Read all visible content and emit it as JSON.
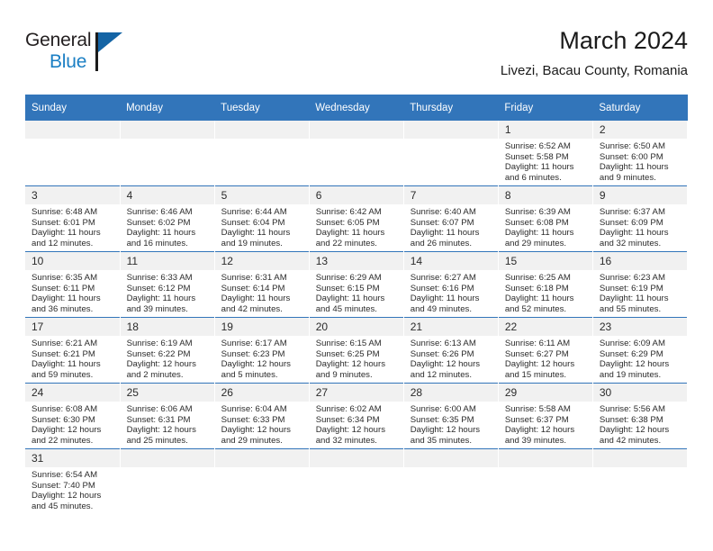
{
  "brand": {
    "name_part1": "General",
    "name_part2": "Blue",
    "logo_icon": "triangle-flag-icon"
  },
  "header": {
    "title": "March 2024",
    "subtitle": "Livezi, Bacau County, Romania"
  },
  "theme": {
    "header_blue": "#3275ba",
    "daynum_gray": "#f1f1f1",
    "logo_blue": "#1b7fc4",
    "text": "#2b2b2b"
  },
  "weekday_headers": [
    "Sunday",
    "Monday",
    "Tuesday",
    "Wednesday",
    "Thursday",
    "Friday",
    "Saturday"
  ],
  "weeks": [
    [
      {
        "day": "",
        "empty": true,
        "sunrise": "",
        "sunset": "",
        "daylight1": "",
        "daylight2": ""
      },
      {
        "day": "",
        "empty": true,
        "sunrise": "",
        "sunset": "",
        "daylight1": "",
        "daylight2": ""
      },
      {
        "day": "",
        "empty": true,
        "sunrise": "",
        "sunset": "",
        "daylight1": "",
        "daylight2": ""
      },
      {
        "day": "",
        "empty": true,
        "sunrise": "",
        "sunset": "",
        "daylight1": "",
        "daylight2": ""
      },
      {
        "day": "",
        "empty": true,
        "sunrise": "",
        "sunset": "",
        "daylight1": "",
        "daylight2": ""
      },
      {
        "day": "1",
        "empty": false,
        "sunrise": "Sunrise: 6:52 AM",
        "sunset": "Sunset: 5:58 PM",
        "daylight1": "Daylight: 11 hours",
        "daylight2": "and 6 minutes."
      },
      {
        "day": "2",
        "empty": false,
        "sunrise": "Sunrise: 6:50 AM",
        "sunset": "Sunset: 6:00 PM",
        "daylight1": "Daylight: 11 hours",
        "daylight2": "and 9 minutes."
      }
    ],
    [
      {
        "day": "3",
        "empty": false,
        "sunrise": "Sunrise: 6:48 AM",
        "sunset": "Sunset: 6:01 PM",
        "daylight1": "Daylight: 11 hours",
        "daylight2": "and 12 minutes."
      },
      {
        "day": "4",
        "empty": false,
        "sunrise": "Sunrise: 6:46 AM",
        "sunset": "Sunset: 6:02 PM",
        "daylight1": "Daylight: 11 hours",
        "daylight2": "and 16 minutes."
      },
      {
        "day": "5",
        "empty": false,
        "sunrise": "Sunrise: 6:44 AM",
        "sunset": "Sunset: 6:04 PM",
        "daylight1": "Daylight: 11 hours",
        "daylight2": "and 19 minutes."
      },
      {
        "day": "6",
        "empty": false,
        "sunrise": "Sunrise: 6:42 AM",
        "sunset": "Sunset: 6:05 PM",
        "daylight1": "Daylight: 11 hours",
        "daylight2": "and 22 minutes."
      },
      {
        "day": "7",
        "empty": false,
        "sunrise": "Sunrise: 6:40 AM",
        "sunset": "Sunset: 6:07 PM",
        "daylight1": "Daylight: 11 hours",
        "daylight2": "and 26 minutes."
      },
      {
        "day": "8",
        "empty": false,
        "sunrise": "Sunrise: 6:39 AM",
        "sunset": "Sunset: 6:08 PM",
        "daylight1": "Daylight: 11 hours",
        "daylight2": "and 29 minutes."
      },
      {
        "day": "9",
        "empty": false,
        "sunrise": "Sunrise: 6:37 AM",
        "sunset": "Sunset: 6:09 PM",
        "daylight1": "Daylight: 11 hours",
        "daylight2": "and 32 minutes."
      }
    ],
    [
      {
        "day": "10",
        "empty": false,
        "sunrise": "Sunrise: 6:35 AM",
        "sunset": "Sunset: 6:11 PM",
        "daylight1": "Daylight: 11 hours",
        "daylight2": "and 36 minutes."
      },
      {
        "day": "11",
        "empty": false,
        "sunrise": "Sunrise: 6:33 AM",
        "sunset": "Sunset: 6:12 PM",
        "daylight1": "Daylight: 11 hours",
        "daylight2": "and 39 minutes."
      },
      {
        "day": "12",
        "empty": false,
        "sunrise": "Sunrise: 6:31 AM",
        "sunset": "Sunset: 6:14 PM",
        "daylight1": "Daylight: 11 hours",
        "daylight2": "and 42 minutes."
      },
      {
        "day": "13",
        "empty": false,
        "sunrise": "Sunrise: 6:29 AM",
        "sunset": "Sunset: 6:15 PM",
        "daylight1": "Daylight: 11 hours",
        "daylight2": "and 45 minutes."
      },
      {
        "day": "14",
        "empty": false,
        "sunrise": "Sunrise: 6:27 AM",
        "sunset": "Sunset: 6:16 PM",
        "daylight1": "Daylight: 11 hours",
        "daylight2": "and 49 minutes."
      },
      {
        "day": "15",
        "empty": false,
        "sunrise": "Sunrise: 6:25 AM",
        "sunset": "Sunset: 6:18 PM",
        "daylight1": "Daylight: 11 hours",
        "daylight2": "and 52 minutes."
      },
      {
        "day": "16",
        "empty": false,
        "sunrise": "Sunrise: 6:23 AM",
        "sunset": "Sunset: 6:19 PM",
        "daylight1": "Daylight: 11 hours",
        "daylight2": "and 55 minutes."
      }
    ],
    [
      {
        "day": "17",
        "empty": false,
        "sunrise": "Sunrise: 6:21 AM",
        "sunset": "Sunset: 6:21 PM",
        "daylight1": "Daylight: 11 hours",
        "daylight2": "and 59 minutes."
      },
      {
        "day": "18",
        "empty": false,
        "sunrise": "Sunrise: 6:19 AM",
        "sunset": "Sunset: 6:22 PM",
        "daylight1": "Daylight: 12 hours",
        "daylight2": "and 2 minutes."
      },
      {
        "day": "19",
        "empty": false,
        "sunrise": "Sunrise: 6:17 AM",
        "sunset": "Sunset: 6:23 PM",
        "daylight1": "Daylight: 12 hours",
        "daylight2": "and 5 minutes."
      },
      {
        "day": "20",
        "empty": false,
        "sunrise": "Sunrise: 6:15 AM",
        "sunset": "Sunset: 6:25 PM",
        "daylight1": "Daylight: 12 hours",
        "daylight2": "and 9 minutes."
      },
      {
        "day": "21",
        "empty": false,
        "sunrise": "Sunrise: 6:13 AM",
        "sunset": "Sunset: 6:26 PM",
        "daylight1": "Daylight: 12 hours",
        "daylight2": "and 12 minutes."
      },
      {
        "day": "22",
        "empty": false,
        "sunrise": "Sunrise: 6:11 AM",
        "sunset": "Sunset: 6:27 PM",
        "daylight1": "Daylight: 12 hours",
        "daylight2": "and 15 minutes."
      },
      {
        "day": "23",
        "empty": false,
        "sunrise": "Sunrise: 6:09 AM",
        "sunset": "Sunset: 6:29 PM",
        "daylight1": "Daylight: 12 hours",
        "daylight2": "and 19 minutes."
      }
    ],
    [
      {
        "day": "24",
        "empty": false,
        "sunrise": "Sunrise: 6:08 AM",
        "sunset": "Sunset: 6:30 PM",
        "daylight1": "Daylight: 12 hours",
        "daylight2": "and 22 minutes."
      },
      {
        "day": "25",
        "empty": false,
        "sunrise": "Sunrise: 6:06 AM",
        "sunset": "Sunset: 6:31 PM",
        "daylight1": "Daylight: 12 hours",
        "daylight2": "and 25 minutes."
      },
      {
        "day": "26",
        "empty": false,
        "sunrise": "Sunrise: 6:04 AM",
        "sunset": "Sunset: 6:33 PM",
        "daylight1": "Daylight: 12 hours",
        "daylight2": "and 29 minutes."
      },
      {
        "day": "27",
        "empty": false,
        "sunrise": "Sunrise: 6:02 AM",
        "sunset": "Sunset: 6:34 PM",
        "daylight1": "Daylight: 12 hours",
        "daylight2": "and 32 minutes."
      },
      {
        "day": "28",
        "empty": false,
        "sunrise": "Sunrise: 6:00 AM",
        "sunset": "Sunset: 6:35 PM",
        "daylight1": "Daylight: 12 hours",
        "daylight2": "and 35 minutes."
      },
      {
        "day": "29",
        "empty": false,
        "sunrise": "Sunrise: 5:58 AM",
        "sunset": "Sunset: 6:37 PM",
        "daylight1": "Daylight: 12 hours",
        "daylight2": "and 39 minutes."
      },
      {
        "day": "30",
        "empty": false,
        "sunrise": "Sunrise: 5:56 AM",
        "sunset": "Sunset: 6:38 PM",
        "daylight1": "Daylight: 12 hours",
        "daylight2": "and 42 minutes."
      }
    ],
    [
      {
        "day": "31",
        "empty": false,
        "sunrise": "Sunrise: 6:54 AM",
        "sunset": "Sunset: 7:40 PM",
        "daylight1": "Daylight: 12 hours",
        "daylight2": "and 45 minutes."
      },
      {
        "day": "",
        "empty": true,
        "sunrise": "",
        "sunset": "",
        "daylight1": "",
        "daylight2": ""
      },
      {
        "day": "",
        "empty": true,
        "sunrise": "",
        "sunset": "",
        "daylight1": "",
        "daylight2": ""
      },
      {
        "day": "",
        "empty": true,
        "sunrise": "",
        "sunset": "",
        "daylight1": "",
        "daylight2": ""
      },
      {
        "day": "",
        "empty": true,
        "sunrise": "",
        "sunset": "",
        "daylight1": "",
        "daylight2": ""
      },
      {
        "day": "",
        "empty": true,
        "sunrise": "",
        "sunset": "",
        "daylight1": "",
        "daylight2": ""
      },
      {
        "day": "",
        "empty": true,
        "sunrise": "",
        "sunset": "",
        "daylight1": "",
        "daylight2": ""
      }
    ]
  ]
}
